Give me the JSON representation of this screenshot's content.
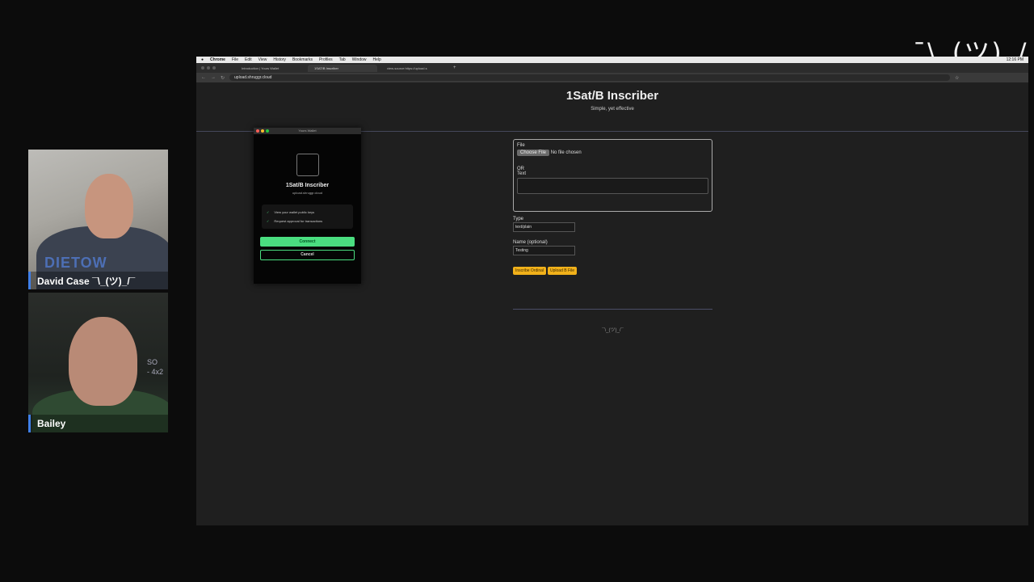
{
  "participants": [
    {
      "name": "David Case ¯\\_(ツ)_/¯",
      "shirt_text": "DIETOW"
    },
    {
      "name": "Bailey"
    }
  ],
  "corner_overlay": "¯\\_(ツ)_/¯",
  "browser": {
    "menu": [
      "Chrome",
      "File",
      "Edit",
      "View",
      "History",
      "Bookmarks",
      "Profiles",
      "Tab",
      "Window",
      "Help"
    ],
    "clock": "12:16 PM",
    "tabs": [
      "Introduction | Yours Wallet",
      "1SAT/B Inscriber",
      "view-source:https://upload.s"
    ],
    "url": "upload.shruggr.cloud"
  },
  "page": {
    "title": "1Sat/B Inscriber",
    "subtitle": "Simple, yet effective",
    "file_label": "File",
    "choose_file": "Choose File",
    "no_file": "No file chosen",
    "or_label": "OR",
    "text_label": "Text",
    "type_label": "Type",
    "type_value": "text/plain",
    "name_label": "Name (optional)",
    "name_value": "Testing",
    "inscribe_button": "Inscribe Ordinal",
    "upload_button": "Upload B File",
    "footer": "¯\\_(ツ)_/¯"
  },
  "wallet_popup": {
    "window_title": "Yours Wallet",
    "app_name": "1Sat/B Inscriber",
    "app_url": "upload.shruggr.cloud",
    "permissions": [
      "View your wallet public keys",
      "Request approval for transactions"
    ],
    "connect": "Connect",
    "cancel": "Cancel"
  }
}
